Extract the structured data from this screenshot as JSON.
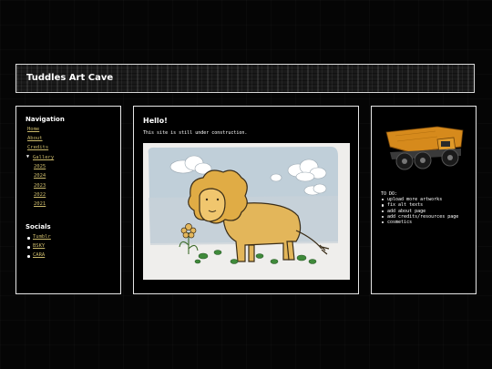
{
  "header": {
    "title": "Tuddles Art Cave"
  },
  "nav": {
    "title": "Navigation",
    "links": [
      "Home",
      "About",
      "Credits"
    ],
    "gallery_label": "Gallery",
    "years": [
      "2025",
      "2024",
      "2023",
      "2022",
      "2021"
    ]
  },
  "socials": {
    "title": "Socials",
    "links": [
      "Tumblr",
      "BSKY",
      "CARA"
    ]
  },
  "main": {
    "heading": "Hello!",
    "subtext": "This site is still under construction."
  },
  "todo": {
    "title": "TO DO:",
    "items": [
      "upload more artworks",
      "fix alt texts",
      "add about page",
      "add credits/resources page",
      "cosmetics"
    ]
  },
  "colors": {
    "link": "#c9b86a",
    "background": "#050505",
    "border": "#e6e6e6"
  }
}
